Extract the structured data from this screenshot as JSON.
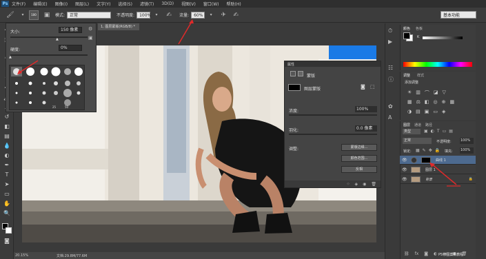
{
  "menu": {
    "logo": "Ps",
    "items": [
      "文件(F)",
      "编辑(E)",
      "图像(I)",
      "图层(L)",
      "文字(Y)",
      "选择(S)",
      "滤镜(T)",
      "3D(D)",
      "视图(V)",
      "窗口(W)",
      "帮助(H)"
    ]
  },
  "options": {
    "brush_size": "100",
    "mode_label": "模式:",
    "mode_value": "正常",
    "opacity_label": "不透明度:",
    "opacity_value": "100%",
    "flow_label": "流量:",
    "flow_value": "60%",
    "workspace": "基本功能"
  },
  "document": {
    "tab": "1, 图层蒙版(RGB/8) *",
    "zoom": "20.15%",
    "doc_info": "文档:29.8M/77.6M"
  },
  "brush_panel": {
    "size_label": "大小:",
    "size_value": "150 像素",
    "hardness_label": "硬度:",
    "hardness_value": "0%",
    "brush_numbers": [
      "25",
      "50"
    ]
  },
  "properties": {
    "title": "属性",
    "mask_label": "蒙版",
    "layer_mask_label": "图层蒙版",
    "density_label": "浓度:",
    "density_value": "100%",
    "feather_label": "羽化:",
    "feather_value": "0.0 像素",
    "adjust_label": "调整:",
    "btn_edge": "蒙版边缘...",
    "btn_color": "颜色范围...",
    "btn_invert": "反相"
  },
  "right": {
    "color_tabs": [
      "颜色",
      "色板"
    ],
    "adjust_tabs": [
      "调整",
      "样式"
    ],
    "add_adjust": "添加调整",
    "layer_tabs": [
      "图层",
      "通道",
      "路径"
    ],
    "kind_label": "类型",
    "blend_mode": "正常",
    "opacity_label": "不透明度:",
    "opacity_value": "100%",
    "lock_label": "锁定:",
    "fill_label": "填充:",
    "fill_value": "100%",
    "layers": [
      {
        "name": "曲线 1"
      },
      {
        "name": "图层 1"
      },
      {
        "name": "背景"
      }
    ]
  },
  "watermark": "PS修图案例教程",
  "colors": {
    "annotation_red": "#e02a2a",
    "selected_layer": "#4d6a8f"
  },
  "icons": [
    "brush-icon",
    "move-icon",
    "marquee-icon",
    "lasso-icon",
    "quick-select-icon",
    "crop-icon",
    "eyedropper-icon",
    "healing-icon",
    "brush-tool-icon",
    "stamp-icon",
    "history-brush-icon",
    "eraser-icon",
    "gradient-icon",
    "blur-icon",
    "dodge-icon",
    "pen-icon",
    "type-icon",
    "path-select-icon",
    "shape-icon",
    "hand-icon",
    "zoom-icon"
  ]
}
